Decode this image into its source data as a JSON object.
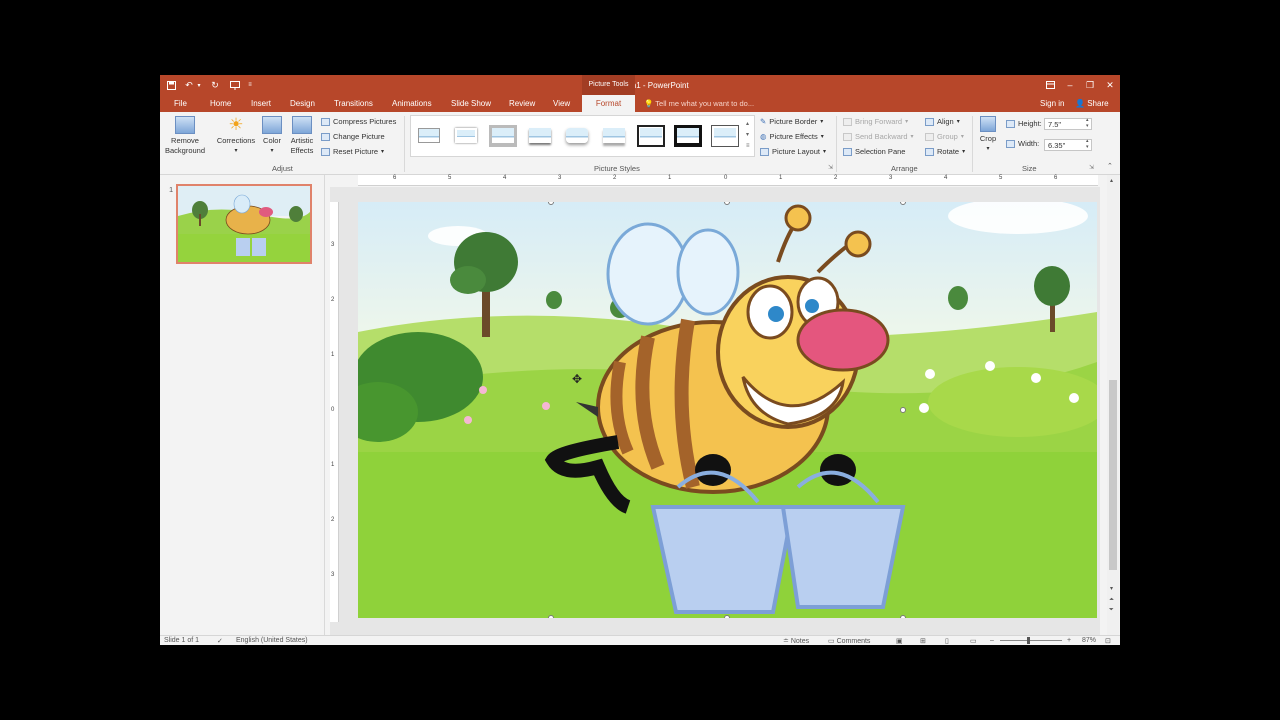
{
  "window": {
    "title": "Presentation1 - PowerPoint",
    "context_tab_group": "Picture Tools",
    "title_color": "#b7472a"
  },
  "tabs": [
    "File",
    "Home",
    "Insert",
    "Design",
    "Transitions",
    "Animations",
    "Slide Show",
    "Review",
    "View",
    "Format"
  ],
  "active_tab": "Format",
  "tell_me_placeholder": "Tell me what you want to do...",
  "account": {
    "signin": "Sign in",
    "share": "Share"
  },
  "ribbon": {
    "adjust": {
      "remove_background": [
        "Remove",
        "Background"
      ],
      "corrections": "Corrections",
      "color": "Color",
      "artistic_effects": [
        "Artistic",
        "Effects"
      ],
      "compress_pictures": "Compress Pictures",
      "change_picture": "Change Picture",
      "reset_picture": "Reset Picture",
      "label": "Adjust"
    },
    "picture_styles": {
      "label": "Picture Styles",
      "picture_border": "Picture Border",
      "picture_effects": "Picture Effects",
      "picture_layout": "Picture Layout"
    },
    "arrange": {
      "label": "Arrange",
      "bring_forward": "Bring Forward",
      "send_backward": "Send Backward",
      "selection_pane": "Selection Pane",
      "align": "Align",
      "group": "Group",
      "rotate": "Rotate"
    },
    "size": {
      "label": "Size",
      "crop": "Crop",
      "height_label": "Height:",
      "height_value": "7.5\"",
      "width_label": "Width:",
      "width_value": "6.35\""
    }
  },
  "slides": {
    "current_number": "1"
  },
  "ruler": {
    "horizontal": [
      "6",
      "5",
      "4",
      "3",
      "2",
      "1",
      "0",
      "1",
      "2",
      "3",
      "4",
      "5",
      "6"
    ],
    "vertical": [
      "3",
      "2",
      "1",
      "0",
      "1",
      "2",
      "3"
    ]
  },
  "status": {
    "slide_info": "Slide 1 of 1",
    "language": "English (United States)",
    "notes": "Notes",
    "comments": "Comments",
    "zoom": "87%"
  }
}
